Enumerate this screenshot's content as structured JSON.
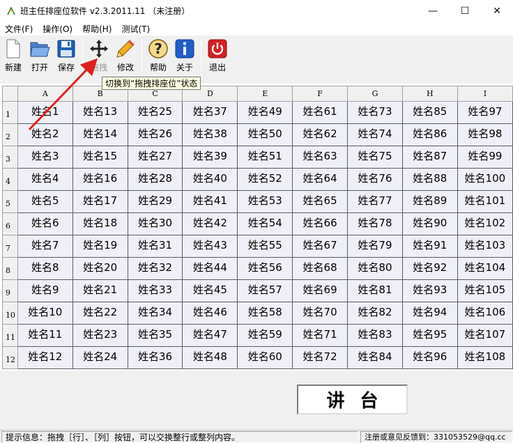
{
  "window": {
    "title": "班主任排座位软件 v2.3.2011.11 （未注册）",
    "minimize_glyph": "—",
    "maximize_glyph": "☐",
    "close_glyph": "✕"
  },
  "menu": [
    "文件(F)",
    "操作(O)",
    "帮助(H)",
    "测试(T)"
  ],
  "toolbar": {
    "new_label": "新建",
    "open_label": "打开",
    "save_label": "保存",
    "drag_label": "拖拽",
    "edit_label": "修改",
    "help_label": "帮助",
    "about_label": "关于",
    "exit_label": "退出",
    "drag_enabled": false
  },
  "tooltip": "切换到“拖拽排座位”状态",
  "grid": {
    "columns": [
      "A",
      "B",
      "C",
      "D",
      "E",
      "F",
      "G",
      "H",
      "I"
    ],
    "rows": [
      {
        "num": "1",
        "cells": [
          "姓名1",
          "姓名13",
          "姓名25",
          "姓名37",
          "姓名49",
          "姓名61",
          "姓名73",
          "姓名85",
          "姓名97"
        ]
      },
      {
        "num": "2",
        "cells": [
          "姓名2",
          "姓名14",
          "姓名26",
          "姓名38",
          "姓名50",
          "姓名62",
          "姓名74",
          "姓名86",
          "姓名98"
        ]
      },
      {
        "num": "3",
        "cells": [
          "姓名3",
          "姓名15",
          "姓名27",
          "姓名39",
          "姓名51",
          "姓名63",
          "姓名75",
          "姓名87",
          "姓名99"
        ]
      },
      {
        "num": "4",
        "cells": [
          "姓名4",
          "姓名16",
          "姓名28",
          "姓名40",
          "姓名52",
          "姓名64",
          "姓名76",
          "姓名88",
          "姓名100"
        ]
      },
      {
        "num": "5",
        "cells": [
          "姓名5",
          "姓名17",
          "姓名29",
          "姓名41",
          "姓名53",
          "姓名65",
          "姓名77",
          "姓名89",
          "姓名101"
        ]
      },
      {
        "num": "6",
        "cells": [
          "姓名6",
          "姓名18",
          "姓名30",
          "姓名42",
          "姓名54",
          "姓名66",
          "姓名78",
          "姓名90",
          "姓名102"
        ]
      },
      {
        "num": "7",
        "cells": [
          "姓名7",
          "姓名19",
          "姓名31",
          "姓名43",
          "姓名55",
          "姓名67",
          "姓名79",
          "姓名91",
          "姓名103"
        ]
      },
      {
        "num": "8",
        "cells": [
          "姓名8",
          "姓名20",
          "姓名32",
          "姓名44",
          "姓名56",
          "姓名68",
          "姓名80",
          "姓名92",
          "姓名104"
        ]
      },
      {
        "num": "9",
        "cells": [
          "姓名9",
          "姓名21",
          "姓名33",
          "姓名45",
          "姓名57",
          "姓名69",
          "姓名81",
          "姓名93",
          "姓名105"
        ]
      },
      {
        "num": "10",
        "cells": [
          "姓名10",
          "姓名22",
          "姓名34",
          "姓名46",
          "姓名58",
          "姓名70",
          "姓名82",
          "姓名94",
          "姓名106"
        ]
      },
      {
        "num": "11",
        "cells": [
          "姓名11",
          "姓名23",
          "姓名35",
          "姓名47",
          "姓名59",
          "姓名71",
          "姓名83",
          "姓名95",
          "姓名107"
        ]
      },
      {
        "num": "12",
        "cells": [
          "姓名12",
          "姓名24",
          "姓名36",
          "姓名48",
          "姓名60",
          "姓名72",
          "姓名84",
          "姓名96",
          "姓名108"
        ]
      }
    ]
  },
  "podium_label": "讲台",
  "status": {
    "hint": "提示信息：拖拽［行］、［列］按钮，可以交换整行或整列内容。",
    "feedback": "注册或意见反馈到：331053529@qq.cc"
  },
  "colors": {
    "accent_arrow": "#e02020",
    "cell_bg": "#efeff7",
    "exit_red": "#d42020",
    "about_blue": "#1e5fc8"
  }
}
